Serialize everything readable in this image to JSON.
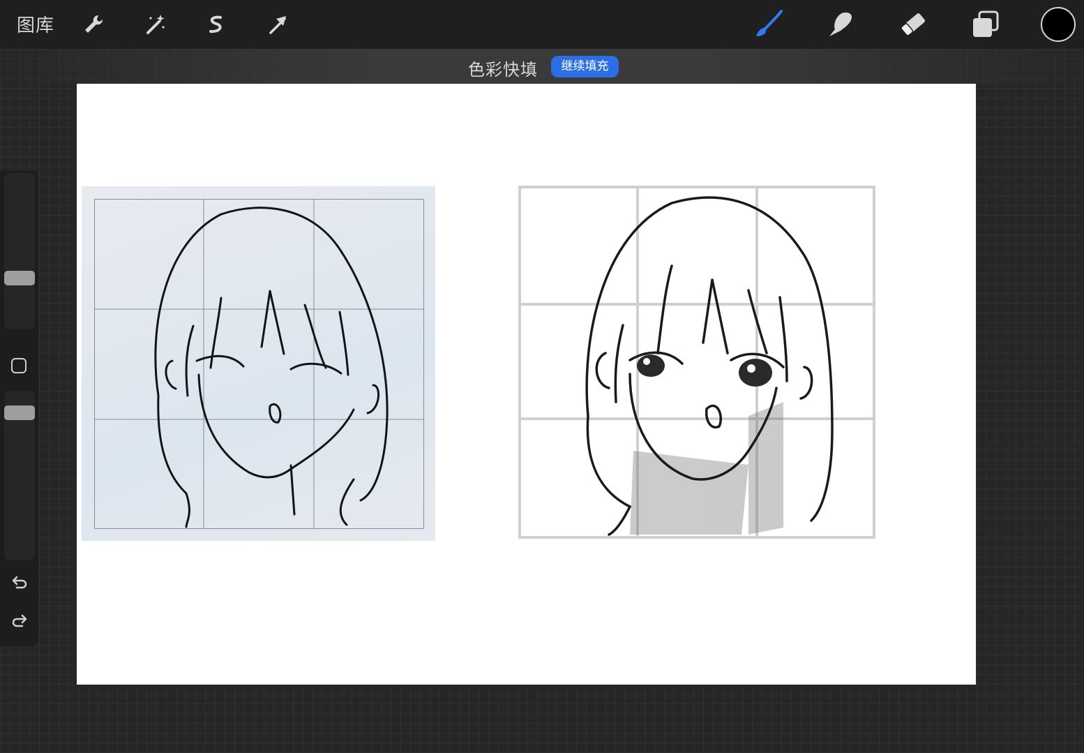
{
  "topbar": {
    "gallery_label": "图库",
    "left_tools": [
      "wrench-icon",
      "magic-wand-icon",
      "selection-s-icon",
      "transform-arrow-icon"
    ],
    "right_tools": [
      "brush-icon",
      "smudge-icon",
      "eraser-icon",
      "layers-icon"
    ],
    "accent_color": "#2f7bf5",
    "current_color": "#000000"
  },
  "status": {
    "mode_label": "色彩快填",
    "continue_label": "继续填充",
    "button_color": "#2b6fe5"
  },
  "sidebar": {
    "brush_size_level": 0.65,
    "opacity_level": 0.95,
    "tools": [
      "modify-button",
      "undo-icon",
      "redo-icon"
    ]
  },
  "canvas": {
    "background": "#ffffff",
    "left_image": "reference-sketch-with-grid",
    "right_image": "pencil-drawing-with-grid"
  }
}
